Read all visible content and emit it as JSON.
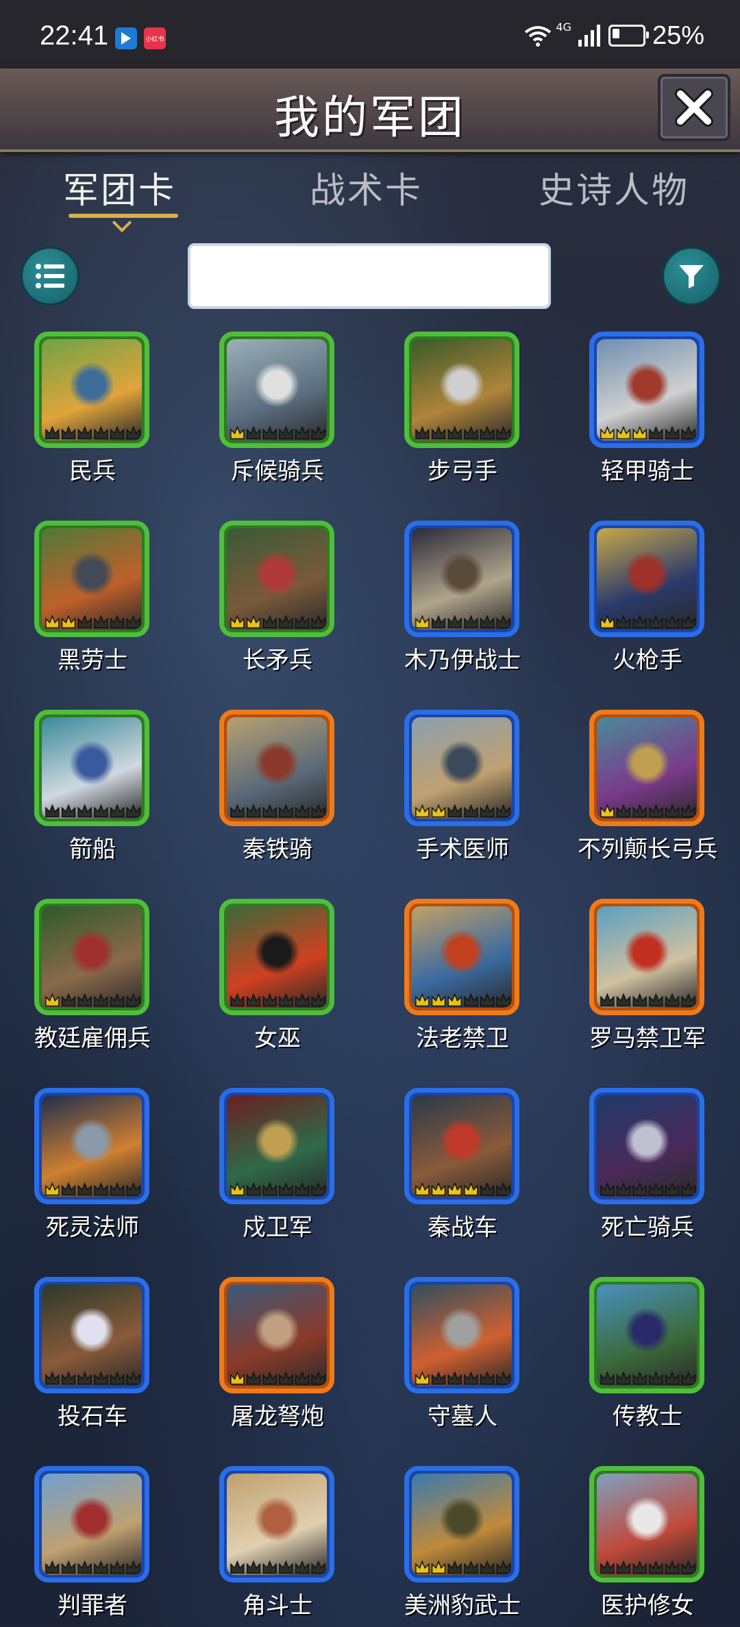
{
  "status_bar": {
    "time": "22:41",
    "app_badge": "小红书",
    "network": "4G",
    "battery": "25%"
  },
  "header": {
    "title": "我的军团"
  },
  "tabs": [
    {
      "label": "军团卡",
      "active": true
    },
    {
      "label": "战术卡",
      "active": false
    },
    {
      "label": "史诗人物",
      "active": false
    }
  ],
  "search": {
    "value": "",
    "placeholder": ""
  },
  "colors": {
    "green_frame": "#4fbf3a",
    "blue_frame": "#2a6ee8",
    "orange_frame": "#f07a1a",
    "teal_button": "#1d6d76",
    "crown": "#e8c21a"
  },
  "cards": [
    {
      "name": "民兵",
      "rarity": "green",
      "stars": 0
    },
    {
      "name": "斥候骑兵",
      "rarity": "green",
      "stars": 1
    },
    {
      "name": "步弓手",
      "rarity": "green",
      "stars": 0
    },
    {
      "name": "轻甲骑士",
      "rarity": "blue",
      "stars": 3
    },
    {
      "name": "黑劳士",
      "rarity": "green",
      "stars": 2
    },
    {
      "name": "长矛兵",
      "rarity": "green",
      "stars": 2
    },
    {
      "name": "木乃伊战士",
      "rarity": "blue",
      "stars": 1
    },
    {
      "name": "火枪手",
      "rarity": "blue",
      "stars": 1
    },
    {
      "name": "箭船",
      "rarity": "green",
      "stars": 0
    },
    {
      "name": "秦铁骑",
      "rarity": "orange",
      "stars": 0
    },
    {
      "name": "手术医师",
      "rarity": "blue",
      "stars": 2
    },
    {
      "name": "不列颠长弓兵",
      "rarity": "orange",
      "stars": 1
    },
    {
      "name": "教廷雇佣兵",
      "rarity": "green",
      "stars": 1
    },
    {
      "name": "女巫",
      "rarity": "green",
      "stars": 0
    },
    {
      "name": "法老禁卫",
      "rarity": "orange",
      "stars": 3
    },
    {
      "name": "罗马禁卫军",
      "rarity": "orange",
      "stars": 0
    },
    {
      "name": "死灵法师",
      "rarity": "blue",
      "stars": 1
    },
    {
      "name": "戍卫军",
      "rarity": "blue",
      "stars": 1
    },
    {
      "name": "秦战车",
      "rarity": "blue",
      "stars": 4
    },
    {
      "name": "死亡骑兵",
      "rarity": "blue",
      "stars": 0
    },
    {
      "name": "投石车",
      "rarity": "blue",
      "stars": 0
    },
    {
      "name": "屠龙弩炮",
      "rarity": "orange",
      "stars": 1
    },
    {
      "name": "守墓人",
      "rarity": "blue",
      "stars": 1
    },
    {
      "name": "传教士",
      "rarity": "green",
      "stars": 0
    },
    {
      "name": "判罪者",
      "rarity": "blue",
      "stars": 0
    },
    {
      "name": "角斗士",
      "rarity": "blue",
      "stars": 0
    },
    {
      "name": "美洲豹武士",
      "rarity": "blue",
      "stars": 2
    },
    {
      "name": "医护修女",
      "rarity": "green",
      "stars": 0
    }
  ]
}
